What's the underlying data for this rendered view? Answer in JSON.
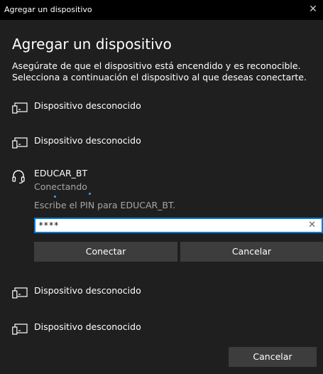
{
  "window": {
    "title": "Agregar un dispositivo",
    "close_glyph": "✕"
  },
  "heading": "Agregar un dispositivo",
  "description": "Asegúrate de que el dispositivo está encendido y es reconocible. Selecciona a continuación el dispositivo al que deseas conectarte.",
  "devices_top": [
    {
      "label": "Dispositivo desconocido",
      "icon": "generic-device-icon"
    },
    {
      "label": "Dispositivo desconocido",
      "icon": "generic-device-icon"
    }
  ],
  "bt_device": {
    "name": "EDUCAR_BT",
    "status": "Conectando",
    "icon": "headset-icon",
    "pin_prompt": "Escribe el PIN para EDUCAR_BT.",
    "pin_value": "****",
    "clear_glyph": "✕",
    "connect_label": "Conectar",
    "cancel_label": "Cancelar"
  },
  "devices_bottom": [
    {
      "label": "Dispositivo desconocido",
      "icon": "generic-device-icon"
    },
    {
      "label": "Dispositivo desconocido",
      "icon": "generic-device-icon"
    }
  ],
  "footer": {
    "cancel_label": "Cancelar"
  },
  "colors": {
    "background": "#1f1f1f",
    "titlebar": "#000000",
    "button": "#3d3d3d",
    "accent": "#0078d7",
    "secondary_text": "#a6a6a6"
  }
}
